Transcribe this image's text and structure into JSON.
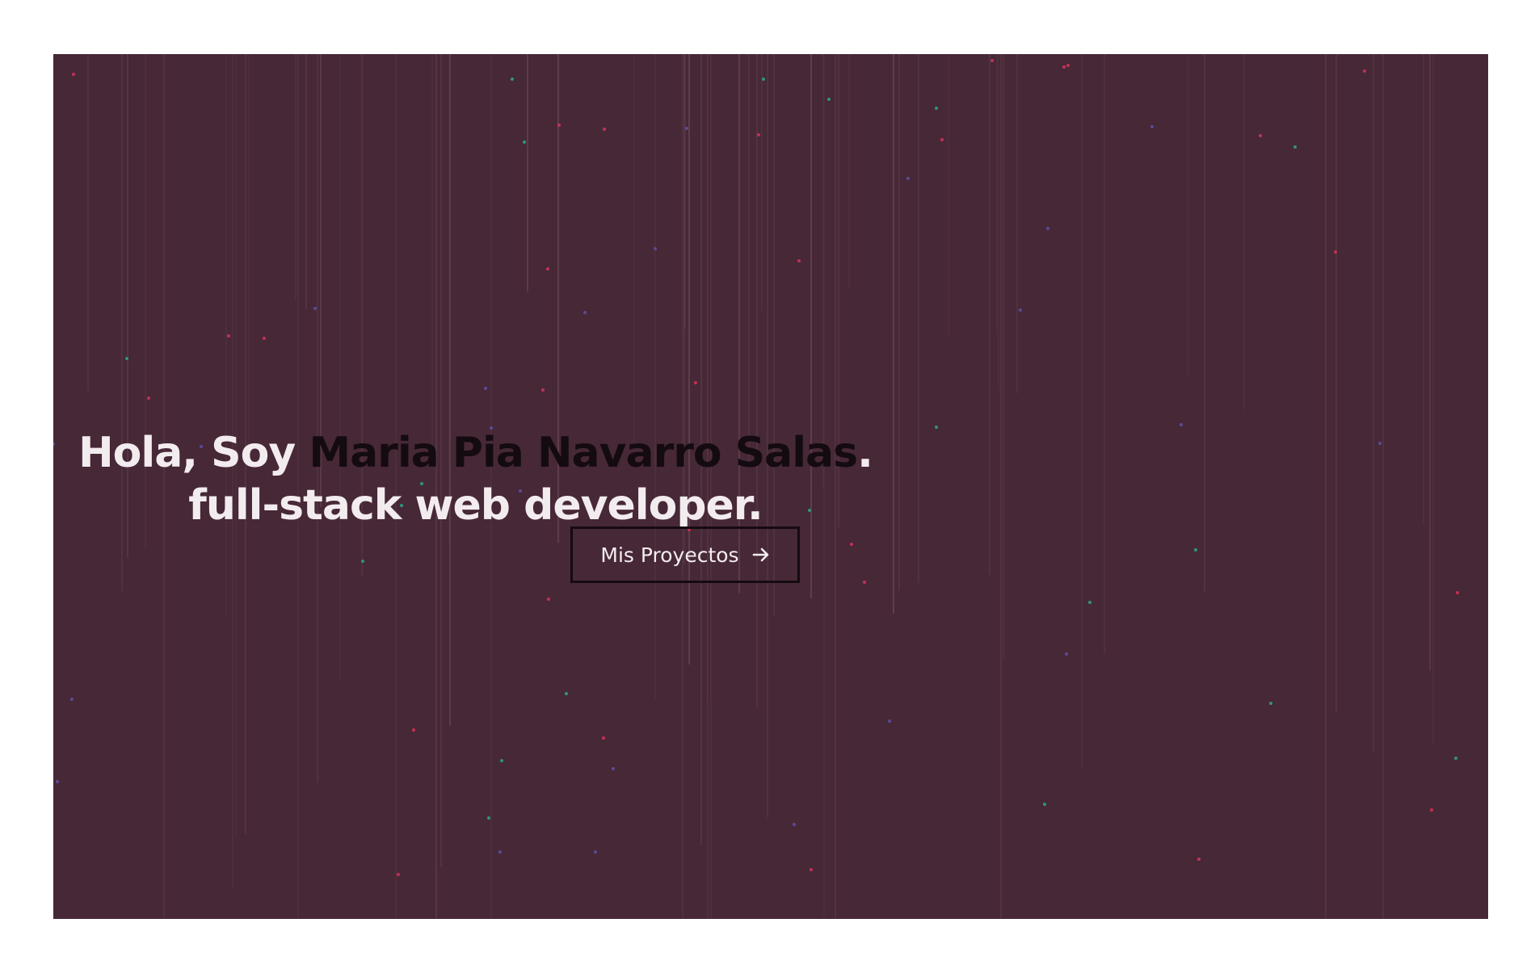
{
  "colors": {
    "hero_background": "#472837",
    "text_light": "#f3ecef",
    "text_name": "#140b10",
    "button_border": "#140b10",
    "rain_line": "#6a4957",
    "dot_palette": [
      "#d2315a",
      "#2e9f88",
      "#5b4fa0"
    ]
  },
  "hero": {
    "greeting": "Hola, Soy ",
    "name": "Maria Pia Navarro Salas",
    "greeting_end": ".",
    "role": "full-stack web developer."
  },
  "cta": {
    "label": "Mis Proyectos",
    "icon": "arrow-right-icon"
  }
}
